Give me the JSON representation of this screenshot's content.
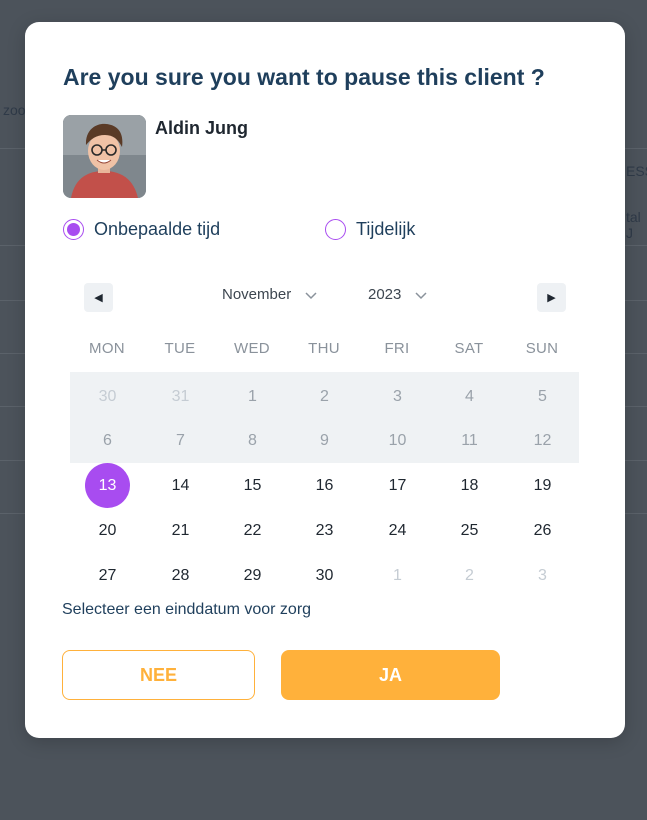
{
  "background": {
    "left_text": "zoo",
    "right_header": "ESS",
    "right_cell": "tal J"
  },
  "modal": {
    "title": "Are you sure you want to pause this client ?",
    "client_name": "Aldin Jung",
    "options": [
      {
        "label": "Onbepaalde tijd",
        "selected": true
      },
      {
        "label": "Tijdelijk",
        "selected": false
      }
    ],
    "calendar": {
      "month": "November",
      "year": "2023",
      "weekdays": [
        "MON",
        "TUE",
        "WED",
        "THU",
        "FRI",
        "SAT",
        "SUN"
      ],
      "weeks": [
        [
          {
            "d": "30",
            "s": "faint"
          },
          {
            "d": "31",
            "s": "faint"
          },
          {
            "d": "1",
            "s": "past"
          },
          {
            "d": "2",
            "s": "past"
          },
          {
            "d": "3",
            "s": "past"
          },
          {
            "d": "4",
            "s": "past"
          },
          {
            "d": "5",
            "s": "past"
          }
        ],
        [
          {
            "d": "6",
            "s": "past"
          },
          {
            "d": "7",
            "s": "past"
          },
          {
            "d": "8",
            "s": "past"
          },
          {
            "d": "9",
            "s": "past"
          },
          {
            "d": "10",
            "s": "past"
          },
          {
            "d": "11",
            "s": "past"
          },
          {
            "d": "12",
            "s": "past"
          }
        ],
        [
          {
            "d": "13",
            "s": "selected"
          },
          {
            "d": "14",
            "s": "normal"
          },
          {
            "d": "15",
            "s": "normal"
          },
          {
            "d": "16",
            "s": "normal"
          },
          {
            "d": "17",
            "s": "normal"
          },
          {
            "d": "18",
            "s": "normal"
          },
          {
            "d": "19",
            "s": "normal"
          }
        ],
        [
          {
            "d": "20",
            "s": "normal"
          },
          {
            "d": "21",
            "s": "normal"
          },
          {
            "d": "22",
            "s": "normal"
          },
          {
            "d": "23",
            "s": "normal"
          },
          {
            "d": "24",
            "s": "normal"
          },
          {
            "d": "25",
            "s": "normal"
          },
          {
            "d": "26",
            "s": "normal"
          }
        ],
        [
          {
            "d": "27",
            "s": "normal"
          },
          {
            "d": "28",
            "s": "normal"
          },
          {
            "d": "29",
            "s": "normal"
          },
          {
            "d": "30",
            "s": "normal"
          },
          {
            "d": "1",
            "s": "faint"
          },
          {
            "d": "2",
            "s": "faint"
          },
          {
            "d": "3",
            "s": "faint"
          }
        ]
      ],
      "selected_day": "13"
    },
    "hint": "Selecteer een einddatum voor zorg",
    "buttons": {
      "no": "NEE",
      "yes": "JA"
    },
    "colors": {
      "accent": "#a84cf0",
      "primary": "#ffb13b",
      "title": "#1f3f5c"
    }
  }
}
